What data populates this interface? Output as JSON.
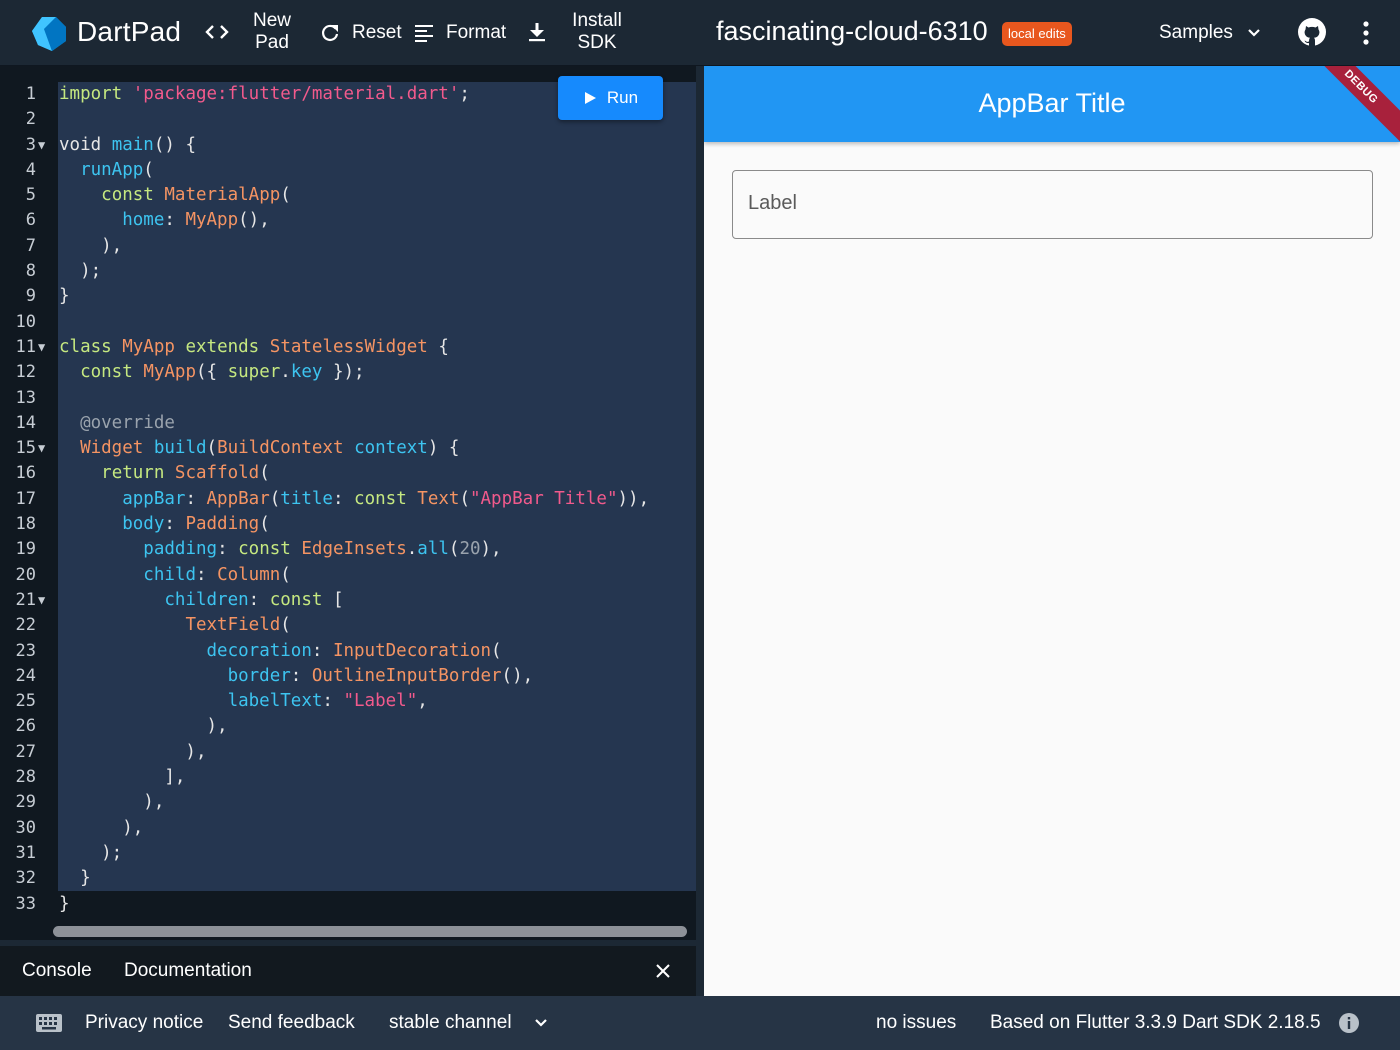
{
  "header": {
    "brand": "DartPad",
    "new_pad_line1": "New",
    "new_pad_line2": "Pad",
    "reset_label": "Reset",
    "format_label": "Format",
    "install_line1": "Install",
    "install_line2": "SDK",
    "pad_title": "fascinating-cloud-6310",
    "badge": "local edits",
    "samples_label": "Samples"
  },
  "editor": {
    "run_label": "Run",
    "line_numbers": [
      "1",
      "2",
      "3",
      "4",
      "5",
      "6",
      "7",
      "8",
      "9",
      "10",
      "11",
      "12",
      "13",
      "14",
      "15",
      "16",
      "17",
      "18",
      "19",
      "20",
      "21",
      "22",
      "23",
      "24",
      "25",
      "26",
      "27",
      "28",
      "29",
      "30",
      "31",
      "32",
      "33"
    ],
    "code_lines": [
      "import 'package:flutter/material.dart';",
      "",
      "void main() {",
      "  runApp(",
      "    const MaterialApp(",
      "      home: MyApp(),",
      "    ),",
      "  );",
      "}",
      "",
      "class MyApp extends StatelessWidget {",
      "  const MyApp({ super.key });",
      "",
      "  @override",
      "  Widget build(BuildContext context) {",
      "    return Scaffold(",
      "      appBar: AppBar(title: const Text(\"AppBar Title\")),",
      "      body: Padding(",
      "        padding: const EdgeInsets.all(20),",
      "        child: Column(",
      "          children: const [",
      "            TextField(",
      "              decoration: InputDecoration(",
      "                border: OutlineInputBorder(),",
      "                labelText: \"Label\",",
      "              ),",
      "            ),",
      "          ],",
      "        ),",
      "      ),",
      "    );",
      "  }",
      "}"
    ]
  },
  "console": {
    "tab_console": "Console",
    "tab_docs": "Documentation"
  },
  "preview": {
    "appbar_title": "AppBar Title",
    "debug_banner": "DEBUG",
    "field_label": "Label"
  },
  "footer": {
    "privacy": "Privacy notice",
    "feedback": "Send feedback",
    "channel": "stable channel",
    "issues": "no issues",
    "version": "Based on Flutter 3.3.9 Dart SDK 2.18.5"
  },
  "colors": {
    "header_bg": "#1c2834",
    "editor_bg": "#101820",
    "selection": "#253650",
    "run_button": "#168afd",
    "appbar": "#2196f3",
    "badge": "#e8571e",
    "debug_banner": "#a8213c"
  }
}
